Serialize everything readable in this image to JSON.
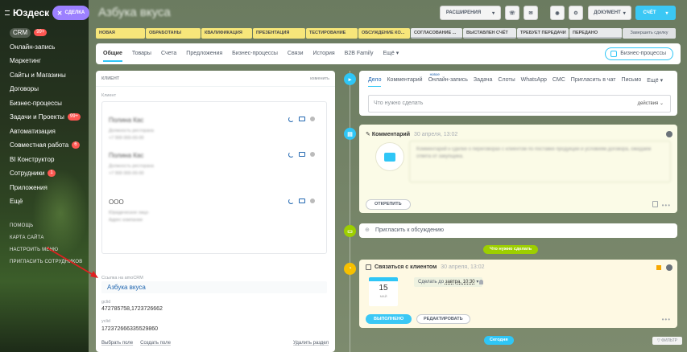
{
  "sidebar": {
    "logo": "Юздеск",
    "items": [
      {
        "label": "CRM",
        "badge": "99+"
      },
      {
        "label": "Онлайн-запись"
      },
      {
        "label": "Маркетинг"
      },
      {
        "label": "Сайты и Магазины"
      },
      {
        "label": "Договоры"
      },
      {
        "label": "Бизнес-процессы"
      },
      {
        "label": "Задачи и Проекты",
        "badge": "99+"
      },
      {
        "label": "Автоматизация"
      },
      {
        "label": "Совместная работа",
        "badge": "6"
      },
      {
        "label": "BI Конструктор"
      },
      {
        "label": "Сотрудники",
        "badge": "1"
      },
      {
        "label": "Приложения"
      },
      {
        "label": "Ещё"
      }
    ],
    "small_links": [
      "ПОМОЩЬ",
      "КАРТА САЙТА",
      "НАСТРОИТЬ МЕНЮ",
      "ПРИГЛАСИТЬ СОТРУДНИКОВ"
    ]
  },
  "header": {
    "new_label": "СДЕЛКА",
    "title": "Азбука вкуса",
    "extensions_label": "РАСШИРЕНИЯ",
    "document_label": "ДОКУМЕНТ",
    "invoice_label": "СЧЁТ"
  },
  "stages": [
    {
      "label": "НОВАЯ",
      "kind": "y"
    },
    {
      "label": "ОБРАБОТАНЫ",
      "kind": "y"
    },
    {
      "label": "КВАЛИФИКАЦИЯ",
      "kind": "y"
    },
    {
      "label": "ПРЕЗЕНТАЦИЯ",
      "kind": "y"
    },
    {
      "label": "ТЕСТИРОВАНИЕ",
      "kind": "y"
    },
    {
      "label": "ОБСУЖДЕНИЕ КО...",
      "kind": "y"
    },
    {
      "label": "СОГЛАСОВАНИЕ ...",
      "kind": "g"
    },
    {
      "label": "ВЫСТАВЛЕН СЧЁТ",
      "kind": "g"
    },
    {
      "label": "ТРЕБУЕТ ПЕРЕДАЧИ",
      "kind": "g"
    },
    {
      "label": "ПЕРЕДАНО",
      "kind": "g"
    },
    {
      "label": "Завершить сделку",
      "kind": "last"
    }
  ],
  "tabs": [
    "Общие",
    "Товары",
    "Счета",
    "Предложения",
    "Бизнес-процессы",
    "Связи",
    "История",
    "B2B Family",
    "Ещё"
  ],
  "bp_button": "Бизнес-процессы",
  "client_card": {
    "heading": "КЛИЕНТ",
    "edit": "изменить",
    "client_label": "Клиент",
    "contacts": [
      {
        "name": "Полина Кас",
        "sub1": "Должность ресторана",
        "sub2": "+7 900 000-00-00"
      },
      {
        "name": "Полина Кас",
        "sub1": "Должность ресторана",
        "sub2": "+7 900 000-00-00"
      },
      {
        "name": "ООО",
        "sub1": "Юридическое лицо",
        "sub2": "Адрес компании"
      }
    ],
    "link_label": "Ссылка на amoCRM",
    "link_value": "Азбука вкуса",
    "field1_label": "gclid",
    "field1_value": "472785758,1723726662",
    "field2_label": "yclid",
    "field2_value": "172372666335529860",
    "footer": [
      "Выбрать поле",
      "Создать поле",
      "Удалить раздел"
    ]
  },
  "activity": {
    "tabs": [
      "Дело",
      "Комментарий",
      "Онлайн-запись",
      "Задача",
      "Слоты",
      "WhatsApp",
      "СМС",
      "Пригласить в чат",
      "Письмо",
      "Ещё"
    ],
    "new_badge": "новое",
    "todo_placeholder": "Что нужно сделать",
    "todo_action": "действия"
  },
  "comment": {
    "title": "Комментарий",
    "date": "30 апреля, 13:02",
    "text": "Комментарий к сделке о переговорах с клиентом по поставке продукции и условиям договора, ожидаем ответа от закупщика.",
    "pin_label": "ОТКРЕПИТЬ"
  },
  "invite_label": "Пригласить к обсуждению",
  "plan_chip": "Что нужно сделать",
  "task": {
    "title": "Связаться с клиентом",
    "date": "30 апреля, 13:02",
    "cal_day": "15",
    "cal_month": "МАЙ",
    "deadline_prefix": "Сделать до",
    "deadline_value": "завтра, 10:30",
    "done_label": "ВЫПОЛНЕНО",
    "edit_label": "РЕДАКТИРОВАТЬ"
  },
  "today_chip": "Сегодня",
  "filter_label": "ФИЛЬТР"
}
